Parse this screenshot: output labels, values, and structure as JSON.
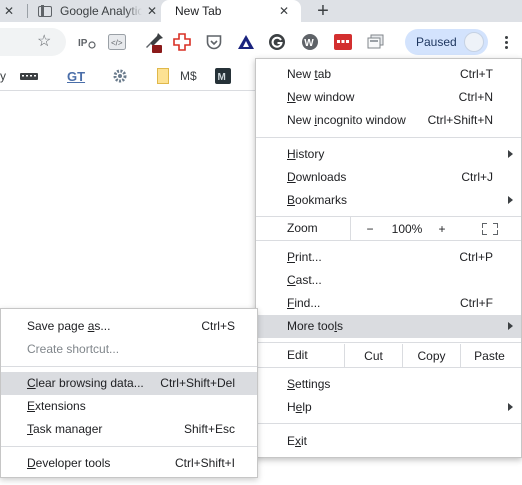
{
  "tabs": {
    "ga_title": "Google Analytics",
    "active_title": "New Tab",
    "close_glyph": "✕",
    "new_tab_glyph": "+"
  },
  "toolbar": {
    "star_glyph": "☆",
    "extensions": [
      {
        "name": "ip-extension-icon",
        "text": "IP"
      },
      {
        "name": "code-extension-icon",
        "text": "</>"
      },
      {
        "name": "eyedropper-extension-icon",
        "text": ""
      },
      {
        "name": "red-cross-extension-icon",
        "text": ""
      },
      {
        "name": "pocket-extension-icon",
        "text": ""
      },
      {
        "name": "triangle-extension-icon",
        "text": ""
      },
      {
        "name": "g-circle-extension-icon",
        "text": ""
      },
      {
        "name": "w-circle-extension-icon",
        "text": "W"
      },
      {
        "name": "red-grid-extension-icon",
        "text": ""
      },
      {
        "name": "cards-extension-icon",
        "text": ""
      }
    ],
    "paused_label": "Paused"
  },
  "bookmarks": {
    "items": [
      {
        "name": "bookmark-y",
        "text": "y"
      },
      {
        "name": "bookmark-keyboard",
        "text": ""
      },
      {
        "name": "bookmark-gt",
        "text": "GT"
      },
      {
        "name": "bookmark-settings",
        "text": ""
      },
      {
        "name": "bookmark-folder",
        "text": ""
      },
      {
        "name": "bookmark-ms",
        "text": "M$"
      },
      {
        "name": "bookmark-m",
        "text": "M"
      }
    ]
  },
  "menu": {
    "new_tab": {
      "pre": "New ",
      "u": "t",
      "post": "ab",
      "shortcut": "Ctrl+T"
    },
    "new_window": {
      "pre": "",
      "u": "N",
      "post": "ew window",
      "shortcut": "Ctrl+N"
    },
    "new_incognito": {
      "pre": "New ",
      "u": "i",
      "post": "ncognito window",
      "shortcut": "Ctrl+Shift+N"
    },
    "history": {
      "pre": "",
      "u": "H",
      "post": "istory"
    },
    "downloads": {
      "pre": "",
      "u": "D",
      "post": "ownloads",
      "shortcut": "Ctrl+J"
    },
    "bookmarks": {
      "pre": "",
      "u": "B",
      "post": "ookmarks"
    },
    "zoom": {
      "label": "Zoom",
      "minus": "−",
      "value": "100%",
      "plus": "+"
    },
    "print": {
      "pre": "",
      "u": "P",
      "post": "rint...",
      "shortcut": "Ctrl+P"
    },
    "cast": {
      "pre": "",
      "u": "C",
      "post": "ast..."
    },
    "find": {
      "pre": "",
      "u": "F",
      "post": "ind...",
      "shortcut": "Ctrl+F"
    },
    "more_tools": {
      "pre": "More too",
      "u": "l",
      "post": "s"
    },
    "edit": {
      "label": "Edit",
      "cut": "Cut",
      "copy": "Copy",
      "paste": "Paste"
    },
    "settings": {
      "pre": "",
      "u": "S",
      "post": "ettings"
    },
    "help": {
      "pre": "H",
      "u": "e",
      "post": "lp"
    },
    "exit": {
      "pre": "E",
      "u": "x",
      "post": "it"
    }
  },
  "submenu": {
    "save_page": {
      "pre": "Save page ",
      "u": "a",
      "post": "s...",
      "shortcut": "Ctrl+S"
    },
    "create_shortcut": {
      "label": "Create shortcut..."
    },
    "clear_browsing": {
      "pre": "",
      "u": "C",
      "post": "lear browsing data...",
      "shortcut": "Ctrl+Shift+Del"
    },
    "extensions": {
      "pre": "",
      "u": "E",
      "post": "xtensions"
    },
    "task_manager": {
      "pre": "",
      "u": "T",
      "post": "ask manager",
      "shortcut": "Shift+Esc"
    },
    "developer_tools": {
      "pre": "",
      "u": "D",
      "post": "eveloper tools",
      "shortcut": "Ctrl+Shift+I"
    }
  }
}
